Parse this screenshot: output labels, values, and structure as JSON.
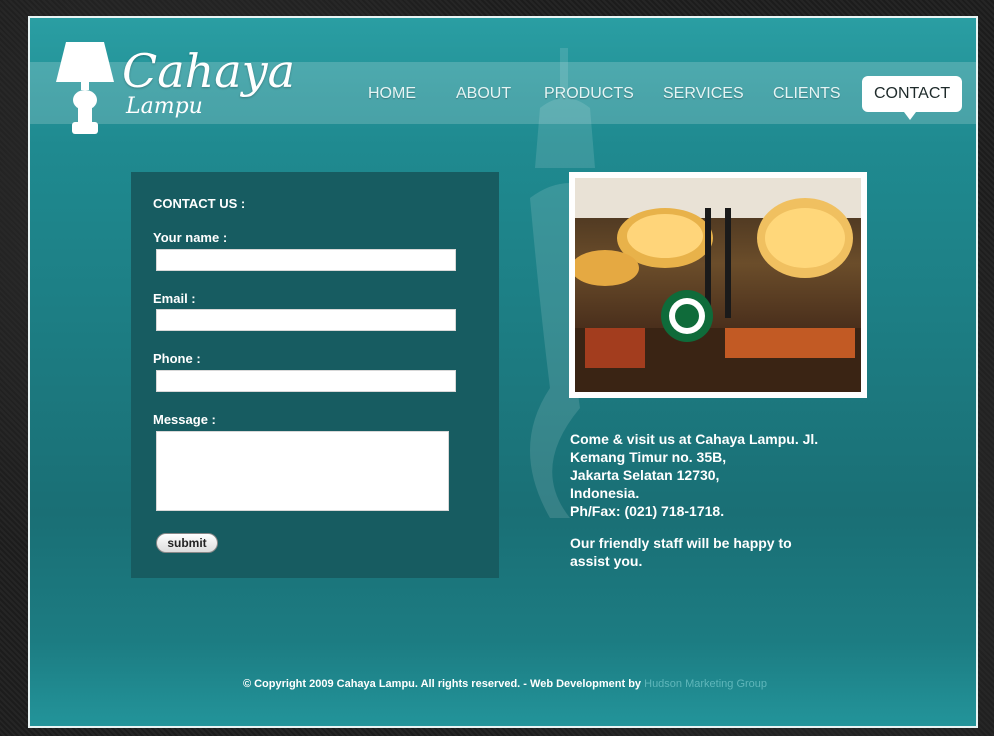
{
  "brand": {
    "name": "Cahaya",
    "sub": "Lampu"
  },
  "nav": {
    "items": [
      {
        "label": "HOME"
      },
      {
        "label": "ABOUT"
      },
      {
        "label": "PRODUCTS"
      },
      {
        "label": "SERVICES"
      },
      {
        "label": "CLIENTS"
      },
      {
        "label": "CONTACT",
        "active": true
      }
    ]
  },
  "contact_form": {
    "title": "CONTACT US :",
    "fields": {
      "name_label": "Your name :",
      "email_label": "Email :",
      "phone_label": "Phone :",
      "message_label": "Message :"
    },
    "submit_label": "submit"
  },
  "address": {
    "line1": "Come & visit us at Cahaya Lampu. Jl.",
    "line2": "Kemang Timur no. 35B,",
    "line3": "Jakarta Selatan 12730,",
    "line4": "Indonesia.",
    "line5": "Ph/Fax: (021) 718-1718.",
    "note1": "Our friendly staff will be happy to",
    "note2": "assist you."
  },
  "footer": {
    "copyright": "© Copyright 2009 Cahaya Lampu. All rights reserved. - Web Development by",
    "developer": "Hudson Marketing Group"
  },
  "colors": {
    "page_bg": "#1e8890",
    "form_bg": "#175c61",
    "nav_active_bg": "#ffffff"
  }
}
